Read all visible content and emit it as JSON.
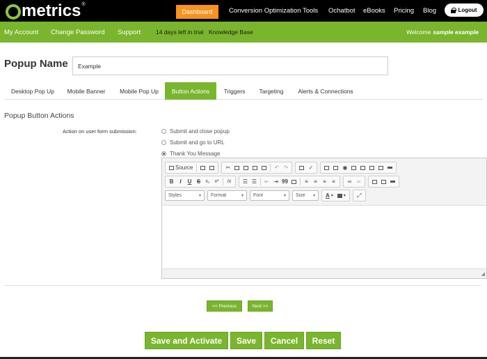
{
  "brand": {
    "logo_text": "metrics",
    "logo_reg": "®",
    "accent_green": "#7ab52e",
    "accent_orange": "#f7931e"
  },
  "topnav": {
    "dashboard_label": "Dashboard",
    "items": [
      "Conversion Optimization Tools",
      "Ochatbot",
      "eBooks",
      "Pricing",
      "Blog"
    ],
    "logout_label": "Logout"
  },
  "subnav": {
    "items": [
      "My Account",
      "Change Password",
      "Support"
    ],
    "trial_text": "14 days left in trial",
    "knowledge_base": "Knowledge Base",
    "welcome_prefix": "Welcome",
    "welcome_user": "sample example"
  },
  "popup": {
    "label": "Popup Name",
    "value": "Example"
  },
  "tabs": [
    {
      "label": "Desktop Pop Up",
      "active": false
    },
    {
      "label": "Mobile Banner",
      "active": false
    },
    {
      "label": "Mobile Pop Up",
      "active": false
    },
    {
      "label": "Button Actions",
      "active": true
    },
    {
      "label": "Triggers",
      "active": false
    },
    {
      "label": "Targeting",
      "active": false
    },
    {
      "label": "Alerts & Connections",
      "active": false
    }
  ],
  "section": {
    "title": "Popup Button Actions",
    "form_label": "Action on user form submission:",
    "options": [
      {
        "label": "Submit and close popup",
        "checked": false
      },
      {
        "label": "Submit and go to URL",
        "checked": false
      },
      {
        "label": "Thank You Message",
        "checked": true
      }
    ]
  },
  "editor": {
    "source_label": "Source",
    "bold": "B",
    "italic": "I",
    "underline": "U",
    "strike": "S",
    "sub": "x₂",
    "sup": "x²",
    "clear": "Ix",
    "quote": "99",
    "styles": "Styles",
    "format": "Format",
    "font": "Font",
    "size": "Size",
    "text_color": "A",
    "resize": "◢"
  },
  "pager": {
    "previous": "<< Previous",
    "next": "Next >>"
  },
  "actions": {
    "save_activate": "Save and Activate",
    "save": "Save",
    "cancel": "Cancel",
    "reset": "Reset"
  }
}
